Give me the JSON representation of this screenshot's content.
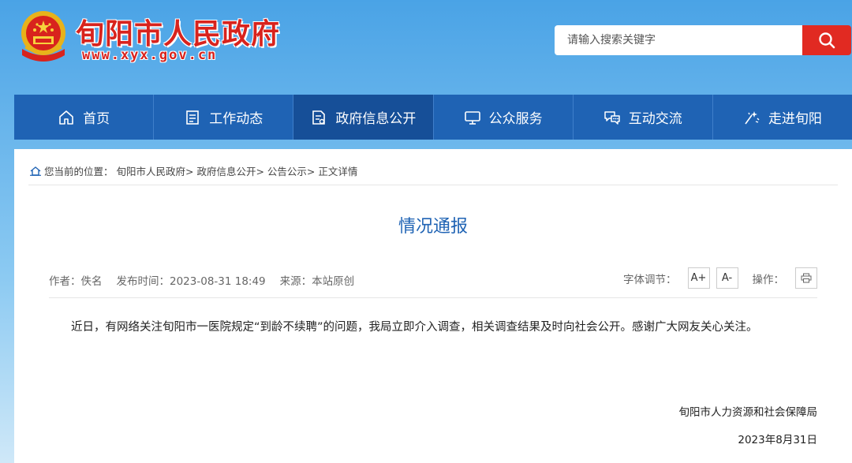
{
  "header": {
    "site_title": "旬阳市人民政府",
    "site_url": "www.xyx.gov.cn",
    "search_placeholder": "请输入搜索关键字"
  },
  "nav": {
    "items": [
      {
        "label": "首页",
        "icon": "home-icon"
      },
      {
        "label": "工作动态",
        "icon": "document-list-icon"
      },
      {
        "label": "政府信息公开",
        "icon": "info-document-icon"
      },
      {
        "label": "公众服务",
        "icon": "monitor-icon"
      },
      {
        "label": "互动交流",
        "icon": "chat-icon"
      },
      {
        "label": "走进旬阳",
        "icon": "sparkle-icon"
      }
    ],
    "active_index": 2
  },
  "breadcrumb": {
    "prefix": "您当前的位置：",
    "path": "旬阳市人民政府> 政府信息公开> 公告公示> 正文详情"
  },
  "article": {
    "title": "情况通报",
    "author": "作者：佚名",
    "publish_time": "发布时间：2023-08-31 18:49",
    "source": "来源：本站原创",
    "font_size_label": "字体调节：",
    "font_increase": "A+",
    "font_decrease": "A-",
    "operation_label": "操作：",
    "body": "近日，有网络关注旬阳市一医院规定“到龄不续聘”的问题，我局立即介入调查，相关调查结果及时向社会公开。感谢广大网友关心关注。",
    "signature_org": "旬阳市人力资源和社会保障局",
    "signature_date": "2023年8月31日"
  },
  "colors": {
    "nav_bg": "#1f63b4",
    "nav_active": "#164f98",
    "title_red": "#d8231d",
    "search_red": "#e12a22",
    "article_title": "#1f63b4"
  }
}
